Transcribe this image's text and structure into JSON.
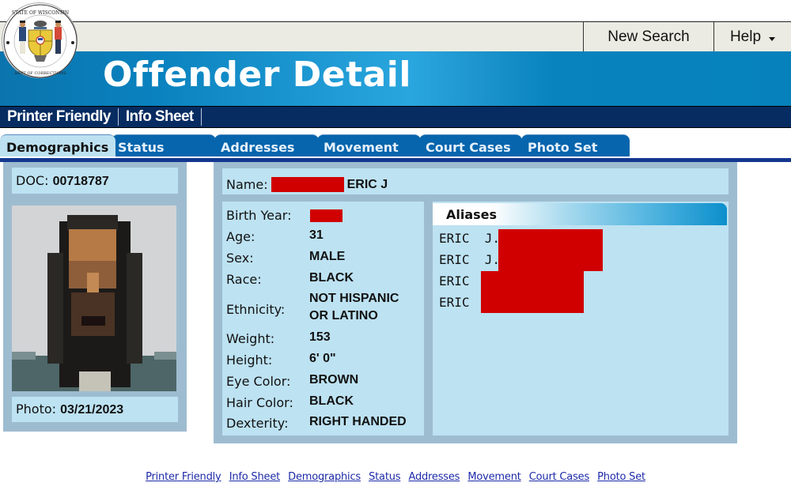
{
  "header": {
    "title": "Offender Detail",
    "seal_label": "State of Wisconsin Department of Corrections",
    "top_buttons": [
      {
        "label": "New Search"
      },
      {
        "label": "Help",
        "icon": "caret-down-icon"
      }
    ]
  },
  "subnav": {
    "links": [
      {
        "label": "Printer Friendly"
      },
      {
        "label": "Info Sheet"
      }
    ]
  },
  "tabs": [
    {
      "label": "Demographics",
      "active": true
    },
    {
      "label": "Status",
      "active": false
    },
    {
      "label": "Addresses",
      "active": false
    },
    {
      "label": "Movement",
      "active": false
    },
    {
      "label": "Court Cases",
      "active": false
    },
    {
      "label": "Photo Set",
      "active": false
    }
  ],
  "left": {
    "doc_label": "DOC:",
    "doc_value": "00718787",
    "photo_label": "Photo:",
    "photo_date": "03/21/2023"
  },
  "main": {
    "name_label": "Name:",
    "name_value": "ERIC J",
    "details": [
      {
        "label": "Birth Year:",
        "value": "",
        "redacted": true
      },
      {
        "label": "Age:",
        "value": "31"
      },
      {
        "label": "Sex:",
        "value": "MALE"
      },
      {
        "label": "Race:",
        "value": "BLACK"
      },
      {
        "label": "Ethnicity:",
        "value": "NOT HISPANIC",
        "value2": "OR LATINO"
      },
      {
        "label": "Weight:",
        "value": "153"
      },
      {
        "label": "Height:",
        "value": "6' 0\""
      },
      {
        "label": "Eye Color:",
        "value": "BROWN"
      },
      {
        "label": "Hair Color:",
        "value": "BLACK"
      },
      {
        "label": "Dexterity:",
        "value": "RIGHT HANDED"
      }
    ],
    "aliases_title": "Aliases",
    "aliases": [
      {
        "text": "ERIC  J."
      },
      {
        "text": "ERIC  J."
      },
      {
        "text": "ERIC"
      },
      {
        "text": "ERIC"
      }
    ]
  },
  "footer": {
    "links": [
      "Printer Friendly",
      "Info Sheet",
      "Demographics",
      "Status",
      "Addresses",
      "Movement",
      "Court Cases",
      "Photo Set"
    ]
  },
  "colors": {
    "banner": "#0a82bf",
    "subnav": "#072c62",
    "tab": "#0665ad",
    "tab_active": "#bde1f0",
    "panel": "#9ebcd0",
    "box": "#bde2f2",
    "redaction": "#d10000",
    "link": "#1d2aa8"
  }
}
